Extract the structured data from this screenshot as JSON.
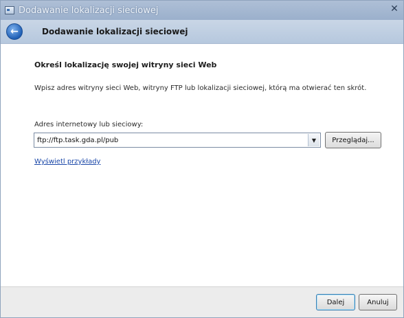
{
  "window": {
    "title": "Dodawanie lokalizacji sieciowej",
    "close_glyph": "✕"
  },
  "nav": {
    "back_icon": "back-arrow-icon",
    "title": "Dodawanie lokalizacji sieciowej"
  },
  "content": {
    "heading": "Określ lokalizację swojej witryny sieci Web",
    "description": "Wpisz adres witryny sieci Web, witryny FTP lub lokalizacji sieciowej, którą ma otwierać ten skrót.",
    "address_label": "Adres internetowy lub sieciowy:",
    "address_value": "ftp://ftp.task.gda.pl/pub",
    "browse_label": "Przeglądaj...",
    "examples_link": "Wyświetl przykłady"
  },
  "footer": {
    "next_label": "Dalej",
    "cancel_label": "Anuluj"
  },
  "colors": {
    "link": "#1a47a8",
    "titlebar": "#9bb0cc",
    "back_button": "#1f5fb5"
  }
}
